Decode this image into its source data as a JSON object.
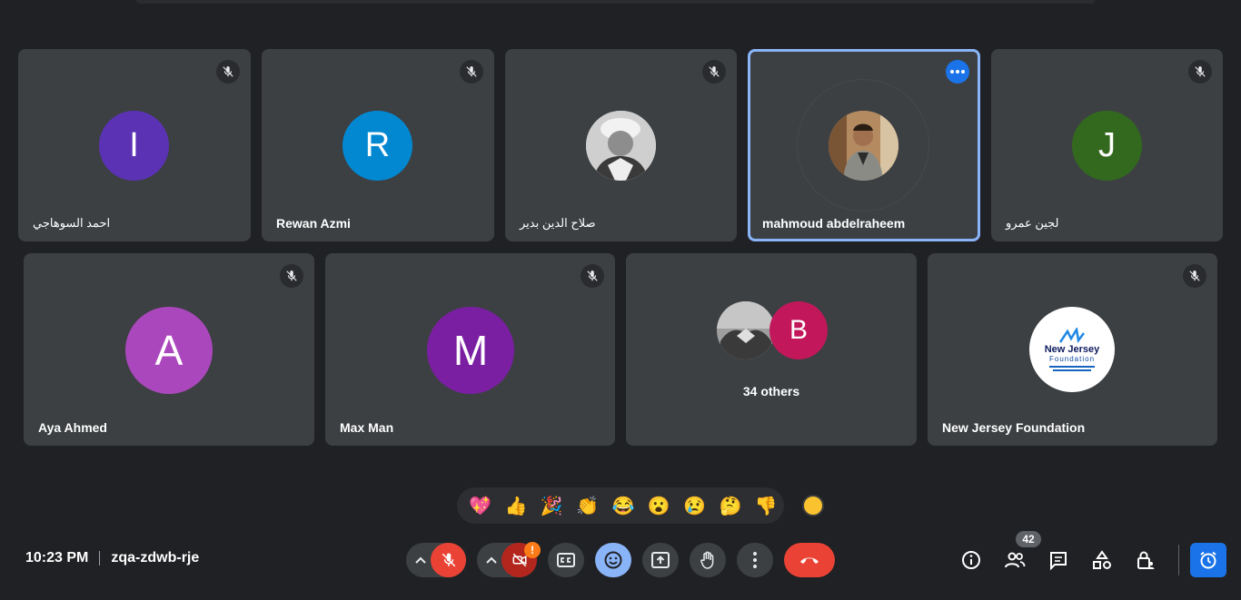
{
  "participants_row1": [
    {
      "name": "احمد السوهاجي",
      "initial": "I",
      "color": "#5b32b4",
      "muted": true
    },
    {
      "name": "Rewan Azmi",
      "initial": "R",
      "color": "#0288d1",
      "muted": true
    },
    {
      "name": "صلاح الدين بدير",
      "initial": "",
      "photo": true,
      "muted": true
    },
    {
      "name": "mahmoud abdelraheem",
      "initial": "",
      "photo": true,
      "active": true
    },
    {
      "name": "لجين عمرو",
      "initial": "J",
      "color": "#33691e",
      "muted": true
    }
  ],
  "participants_row2": [
    {
      "name": "Aya Ahmed",
      "initial": "A",
      "color": "#ab47bc",
      "muted": true
    },
    {
      "name": "Max Man",
      "initial": "M",
      "color": "#7b1fa2",
      "muted": true
    },
    {
      "name": "New Jersey Foundation",
      "logo_text": "New Jersey",
      "logo_sub": "Foundation",
      "muted": true
    }
  ],
  "others": {
    "label": "34 others",
    "initial": "B",
    "color": "#c2185b"
  },
  "reactions": [
    "💖",
    "👍",
    "🎉",
    "👏",
    "😂",
    "😮",
    "😢",
    "🤔",
    "👎"
  ],
  "meeting": {
    "time": "10:23 PM",
    "code": "zqa-zdwb-rje"
  },
  "people_count": "42",
  "camera_warning": "!",
  "colors": {
    "background": "#202124",
    "tile": "#3c4043",
    "hangup": "#ea4335",
    "active_border": "#8ab4f8",
    "accent": "#1a73e8"
  }
}
